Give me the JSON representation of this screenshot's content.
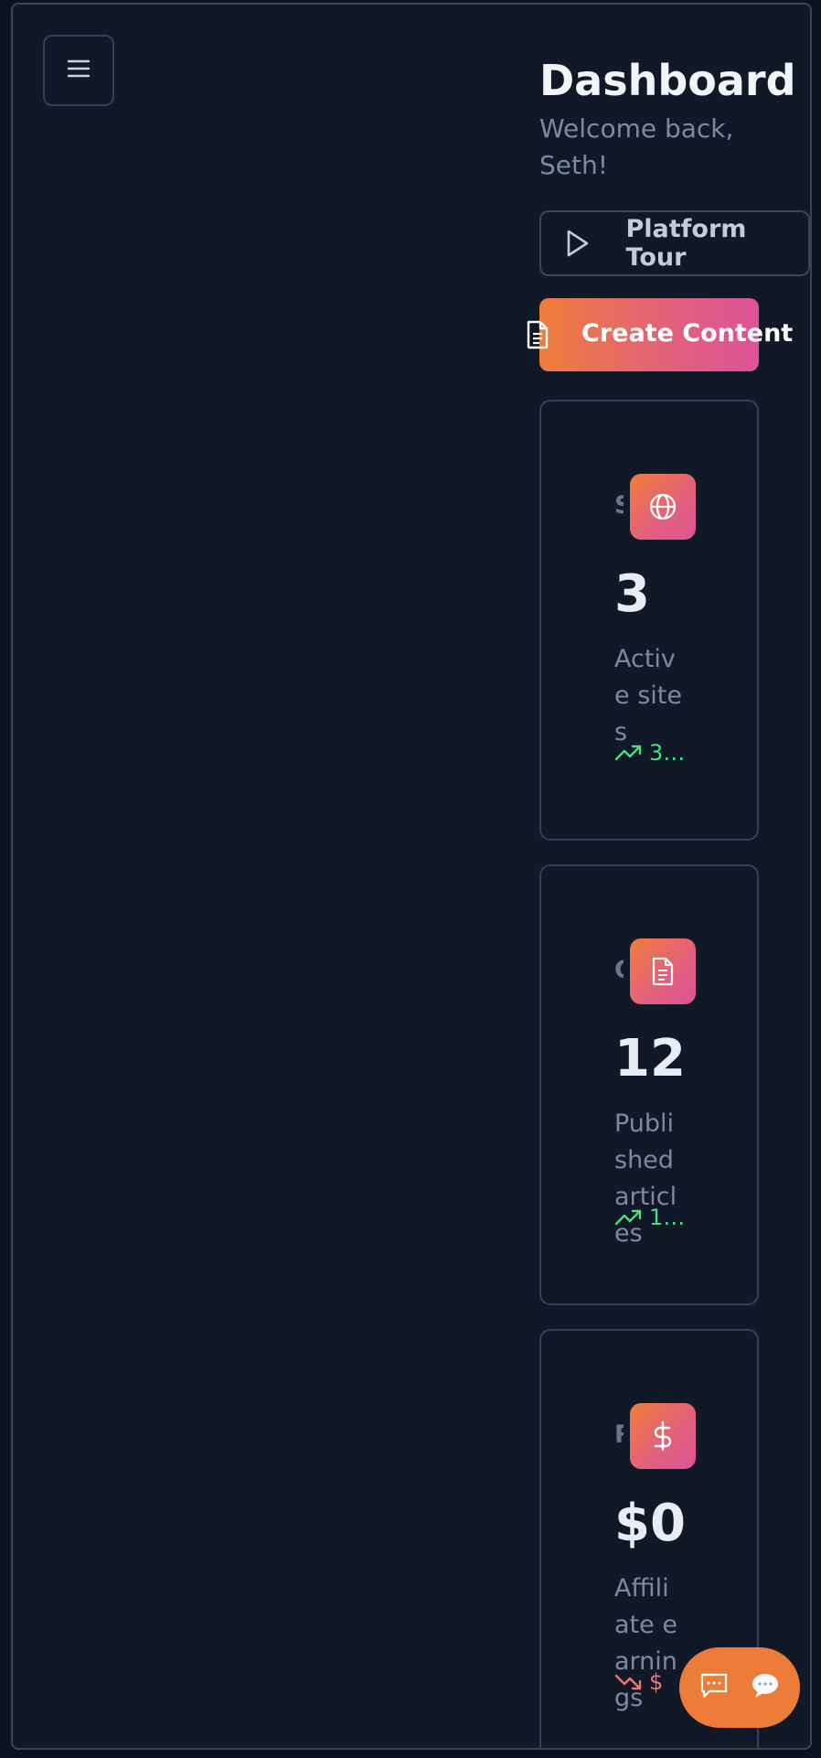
{
  "header": {
    "title": "Dashboard",
    "subtitle": "Welcome back, Seth!"
  },
  "buttons": {
    "tour_label": "Platform Tour",
    "create_label": "Create Content"
  },
  "cards": [
    {
      "label": "S",
      "icon": "globe-icon",
      "value": "3",
      "desc": "Active sites",
      "trend": "3...",
      "trend_dir": "up",
      "trend_color": "#4ade80"
    },
    {
      "label": "C",
      "icon": "document-icon",
      "value": "12",
      "desc": "Published articles",
      "trend": "1...",
      "trend_dir": "up",
      "trend_color": "#4ade80"
    },
    {
      "label": "R",
      "icon": "dollar-icon",
      "value": "$0",
      "desc": "Affiliate earnings",
      "trend": "$",
      "trend_dir": "down",
      "trend_color": "#f87171"
    }
  ],
  "colors": {
    "background": "#111827",
    "accent_start": "#ef7d3a",
    "accent_end": "#dc5497",
    "fab": "#ec7c38"
  }
}
